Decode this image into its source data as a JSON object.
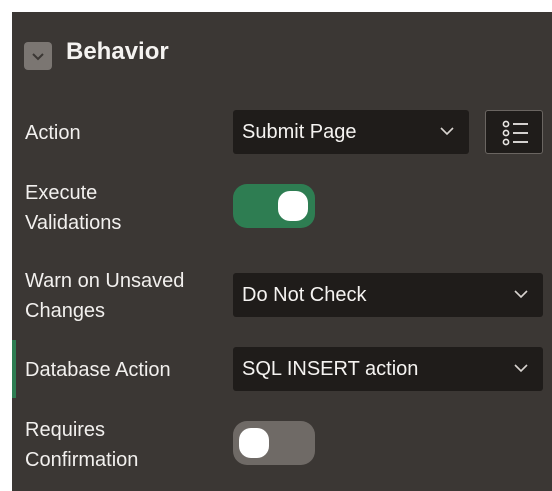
{
  "section": {
    "title": "Behavior",
    "collapsed": false
  },
  "action": {
    "label": "Action",
    "value": "Submit Page",
    "icon": "list-options-icon"
  },
  "execute_validations": {
    "label_line1": "Execute",
    "label_line2": "Validations",
    "enabled": true,
    "on_color": "#2e7d52"
  },
  "warn_unsaved": {
    "label_line1": "Warn on Unsaved",
    "label_line2": "Changes",
    "value": "Do Not Check"
  },
  "database_action": {
    "label": "Database Action",
    "value": "SQL INSERT action",
    "accent_color": "#2e7d52"
  },
  "requires_confirmation": {
    "label_line1": "Requires",
    "label_line2": "Confirmation",
    "enabled": false,
    "off_color": "#6f6a66"
  }
}
